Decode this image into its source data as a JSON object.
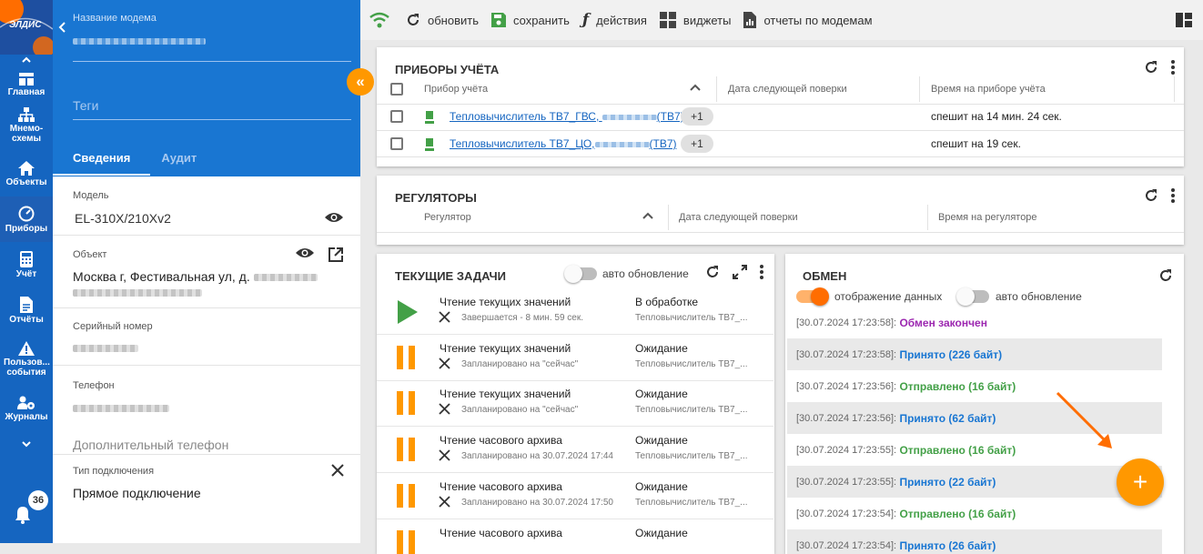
{
  "nav": {
    "logo_text": "ЭЛДИС",
    "items": [
      {
        "label": "Главная",
        "icon": "home-grid-icon"
      },
      {
        "label": "Мнемо-схемы",
        "icon": "sitemap-icon"
      },
      {
        "label": "Объекты",
        "icon": "house-icon"
      },
      {
        "label": "Приборы",
        "icon": "gauge-icon"
      },
      {
        "label": "Учёт",
        "icon": "calculator-icon"
      },
      {
        "label": "Отчёты",
        "icon": "document-icon"
      },
      {
        "label": "Пользов... события",
        "icon": "warning-icon"
      },
      {
        "label": "Журналы",
        "icon": "users-cog-icon"
      }
    ],
    "notifications_count": "36"
  },
  "panel": {
    "modem_name_label": "Название модема",
    "tags_placeholder": "Теги",
    "tabs": [
      "Сведения",
      "Аудит"
    ],
    "model_label": "Модель",
    "model_value": "EL-310X/210Xv2",
    "object_label": "Объект",
    "object_value": "Москва г, Фестивальная ул, д.",
    "serial_label": "Серийный номер",
    "phone_label": "Телефон",
    "extra_phone_label": "Дополнительный телефон",
    "connection_label": "Тип подключения",
    "connection_value": "Прямое подключение"
  },
  "toolbar": {
    "refresh": "обновить",
    "save": "сохранить",
    "actions": "действия",
    "widgets": "виджеты",
    "reports": "отчеты по модемам"
  },
  "meters": {
    "title": "ПРИБОРЫ УЧЁТА",
    "columns": [
      "Прибор учёта",
      "Дата следующей поверки",
      "Время на приборе учёта"
    ],
    "rows": [
      {
        "name": "Тепловычислитель ТВ7_ГВС,",
        "suffix": "(ТВ7)",
        "chip": "+1",
        "time": "спешит на 14 мин. 24 сек."
      },
      {
        "name": "Тепловычислитель ТВ7_ЦО,",
        "suffix": "(ТВ7)",
        "chip": "+1",
        "time": "спешит на 19 сек."
      }
    ]
  },
  "regulators": {
    "title": "РЕГУЛЯТОРЫ",
    "columns": [
      "Регулятор",
      "Дата следующей поверки",
      "Время на регуляторе"
    ]
  },
  "tasks": {
    "title": "ТЕКУЩИЕ ЗАДАЧИ",
    "auto_update_label": "авто обновление",
    "items": [
      {
        "name": "Чтение текущих значений",
        "sub": "Завершается - 8 мин. 59 сек.",
        "status": "В обработке",
        "device": "Тепловычислитель ТВ7_...",
        "state": "running"
      },
      {
        "name": "Чтение текущих значений",
        "sub": "Запланировано на \"сейчас\"",
        "status": "Ожидание",
        "device": "Тепловычислитель ТВ7_...",
        "state": "paused"
      },
      {
        "name": "Чтение текущих значений",
        "sub": "Запланировано на \"сейчас\"",
        "status": "Ожидание",
        "device": "Тепловычислитель ТВ7_...",
        "state": "paused"
      },
      {
        "name": "Чтение часового архива",
        "sub": "Запланировано на 30.07.2024 17:44",
        "status": "Ожидание",
        "device": "Тепловычислитель ТВ7_...",
        "state": "paused"
      },
      {
        "name": "Чтение часового архива",
        "sub": "Запланировано на 30.07.2024 17:50",
        "status": "Ожидание",
        "device": "Тепловычислитель ТВ7_...",
        "state": "paused"
      },
      {
        "name": "Чтение часового архива",
        "sub": "",
        "status": "Ожидание",
        "device": "",
        "state": "paused"
      }
    ]
  },
  "exchange": {
    "title": "ОБМЕН",
    "display_data_label": "отображение данных",
    "auto_update_label": "авто обновление",
    "colors": {
      "finished": "#9c27b0",
      "received": "#1976d2",
      "sent": "#43a047"
    },
    "log": [
      {
        "time": "[30.07.2024 17:23:58]:",
        "text": "Обмен закончен",
        "kind": "finished"
      },
      {
        "time": "[30.07.2024 17:23:58]:",
        "text": "Принято (226 байт)",
        "kind": "received"
      },
      {
        "time": "[30.07.2024 17:23:56]:",
        "text": "Отправлено (16 байт)",
        "kind": "sent"
      },
      {
        "time": "[30.07.2024 17:23:56]:",
        "text": "Принято (62 байт)",
        "kind": "received"
      },
      {
        "time": "[30.07.2024 17:23:55]:",
        "text": "Отправлено (16 байт)",
        "kind": "sent"
      },
      {
        "time": "[30.07.2024 17:23:55]:",
        "text": "Принято (22 байт)",
        "kind": "received"
      },
      {
        "time": "[30.07.2024 17:23:54]:",
        "text": "Отправлено (16 байт)",
        "kind": "sent"
      },
      {
        "time": "[30.07.2024 17:23:54]:",
        "text": "Принято (26 байт)",
        "kind": "received"
      }
    ]
  },
  "fab_symbol": "+"
}
